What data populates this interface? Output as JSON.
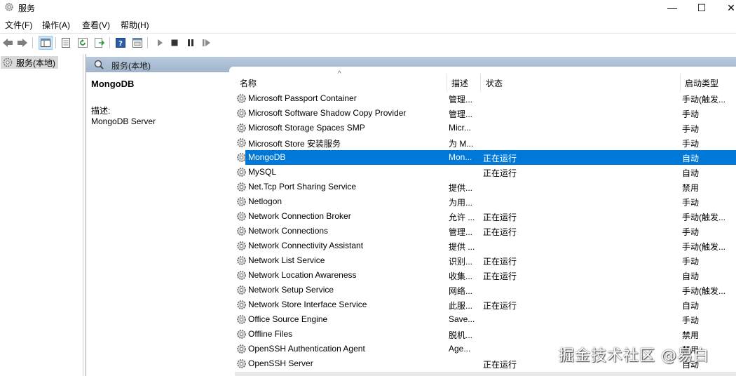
{
  "window": {
    "title": "服务",
    "minimize": "—",
    "maximize": "☐",
    "close": "✕"
  },
  "menu": [
    "文件(F)",
    "操作(A)",
    "查看(V)",
    "帮助(H)"
  ],
  "tree": {
    "root_label": "服务(本地)"
  },
  "header": {
    "label": "服务(本地)"
  },
  "description": {
    "title": "MongoDB",
    "label": "描述:",
    "text": "MongoDB Server"
  },
  "columns": {
    "name": "名称",
    "desc": "描述",
    "status": "状态",
    "startup": "启动类型"
  },
  "services": [
    {
      "name": "Microsoft Passport Container",
      "desc": "管理...",
      "status": "",
      "startup": "手动(触发..."
    },
    {
      "name": "Microsoft Software Shadow Copy Provider",
      "desc": "管理...",
      "status": "",
      "startup": "手动"
    },
    {
      "name": "Microsoft Storage Spaces SMP",
      "desc": "Micr...",
      "status": "",
      "startup": "手动"
    },
    {
      "name": "Microsoft Store 安装服务",
      "desc": "为 M...",
      "status": "",
      "startup": "手动"
    },
    {
      "name": "MongoDB",
      "desc": "Mon...",
      "status": "正在运行",
      "startup": "自动",
      "selected": true
    },
    {
      "name": "MySQL",
      "desc": "",
      "status": "正在运行",
      "startup": "自动"
    },
    {
      "name": "Net.Tcp Port Sharing Service",
      "desc": "提供...",
      "status": "",
      "startup": "禁用"
    },
    {
      "name": "Netlogon",
      "desc": "为用...",
      "status": "",
      "startup": "手动"
    },
    {
      "name": "Network Connection Broker",
      "desc": "允许 ...",
      "status": "正在运行",
      "startup": "手动(触发..."
    },
    {
      "name": "Network Connections",
      "desc": "管理...",
      "status": "正在运行",
      "startup": "手动"
    },
    {
      "name": "Network Connectivity Assistant",
      "desc": "提供 ...",
      "status": "",
      "startup": "手动(触发..."
    },
    {
      "name": "Network List Service",
      "desc": "识别...",
      "status": "正在运行",
      "startup": "手动"
    },
    {
      "name": "Network Location Awareness",
      "desc": "收集...",
      "status": "正在运行",
      "startup": "自动"
    },
    {
      "name": "Network Setup Service",
      "desc": "网络...",
      "status": "",
      "startup": "手动(触发..."
    },
    {
      "name": "Network Store Interface Service",
      "desc": "此服...",
      "status": "正在运行",
      "startup": "自动"
    },
    {
      "name": "Office  Source Engine",
      "desc": "Save...",
      "status": "",
      "startup": "手动"
    },
    {
      "name": "Offline Files",
      "desc": "脱机...",
      "status": "",
      "startup": "禁用"
    },
    {
      "name": "OpenSSH Authentication Agent",
      "desc": "Age...",
      "status": "",
      "startup": "禁用"
    },
    {
      "name": "OpenSSH Server",
      "desc": "",
      "status": "正在运行",
      "startup": "自动"
    }
  ],
  "watermark": "掘金技术社区 @易白",
  "colors": {
    "selection": "#0078d7",
    "header_band": "#a9bdd2"
  },
  "icons": {
    "service": "gear-icon",
    "toolbar": [
      "back-arrow-icon",
      "forward-arrow-icon",
      "console-tree-icon",
      "properties-icon",
      "refresh-icon",
      "export-list-icon",
      "help-icon",
      "view-icon",
      "play-icon",
      "stop-icon",
      "pause-icon",
      "resume-icon"
    ]
  }
}
